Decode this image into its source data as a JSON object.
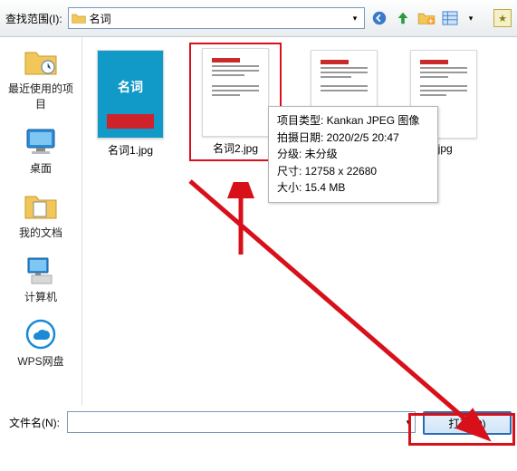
{
  "topbar": {
    "scope_label": "查找范围(I):",
    "folder_name": "名词"
  },
  "places": [
    {
      "label": "最近使用的项目"
    },
    {
      "label": "桌面"
    },
    {
      "label": "我的文档"
    },
    {
      "label": "计算机"
    },
    {
      "label": "WPS网盘"
    }
  ],
  "files": [
    {
      "name": "名词1.jpg",
      "card_text": "名词"
    },
    {
      "name": "名词2.jpg"
    },
    {
      "name_suffix": ".jpg"
    }
  ],
  "tooltip": {
    "line1": "项目类型: Kankan JPEG 图像",
    "line2": "拍摄日期: 2020/2/5 20:47",
    "line3": "分级: 未分级",
    "line4": "尺寸: 12758 x 22680",
    "line5": "大小: 15.4 MB"
  },
  "bottom": {
    "label": "文件名(N):",
    "open_label": "打开(O)"
  }
}
